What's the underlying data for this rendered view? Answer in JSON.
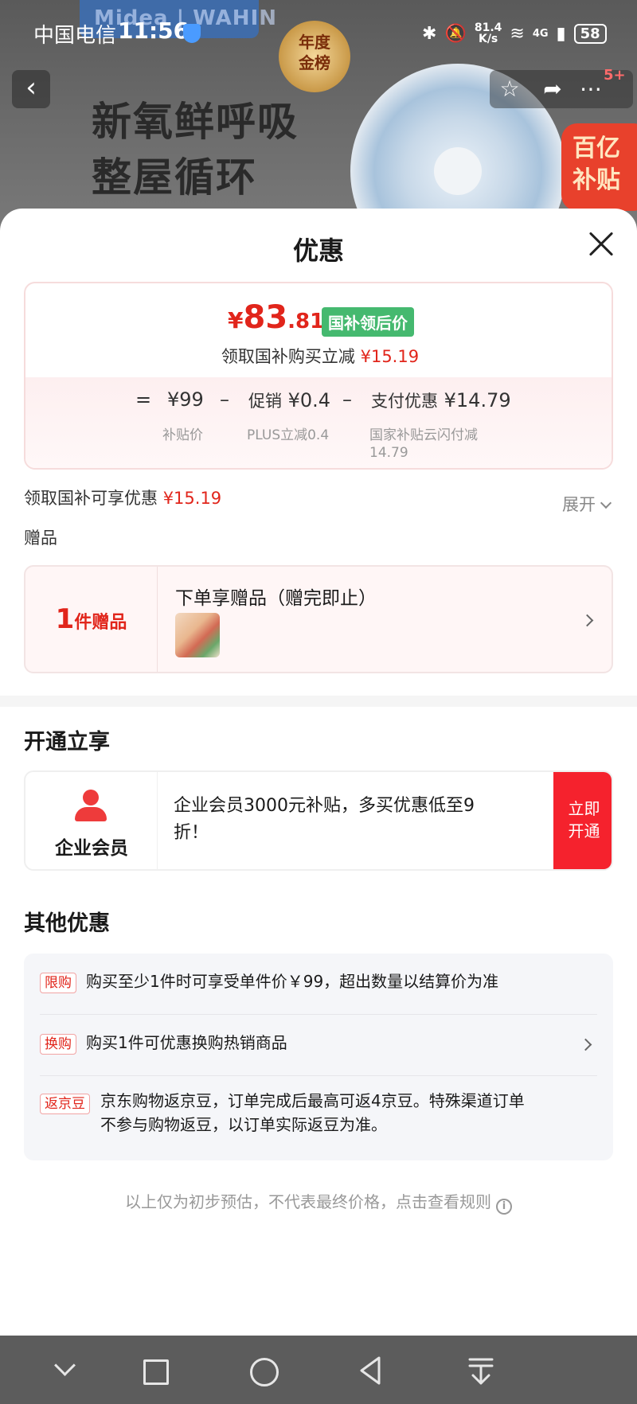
{
  "status_bar": {
    "carrier": "中国电信",
    "time": "11:56",
    "net_speed": "81.4",
    "net_unit": "K/s",
    "network": "4G",
    "battery": "58"
  },
  "banner": {
    "brand": "Midea | WAHIN",
    "award_line1": "年度",
    "award_line2": "金榜",
    "headline_line1": "新氧鲜呼吸",
    "headline_line2": "整屋循环",
    "subsidy_line1": "百亿",
    "subsidy_line2": "补贴",
    "badge": "5+"
  },
  "sheet": {
    "title": "优惠",
    "final_price": {
      "symbol": "¥",
      "integer": "83",
      "decimal": ".81"
    },
    "final_price_tag": "国补领后价",
    "claim_line": {
      "text": "领取国补购买立减",
      "amount": "¥15.19"
    },
    "calc": {
      "equals": "=",
      "base_price": "¥99",
      "base_label": "补贴价",
      "minus1": "–",
      "promo_label": "促销",
      "promo_value": "¥0.4",
      "promo_sub": "PLUS立减0.4",
      "minus2": "–",
      "pay_label": "支付优惠",
      "pay_value": "¥14.79",
      "pay_sub_line1": "国家补贴云闪付减",
      "pay_sub_line2": "14.79"
    },
    "claim_summary": {
      "text": "领取国补可享优惠",
      "amount": "¥15.19"
    },
    "expand_label": "展开",
    "gift_section_label": "赠品",
    "gift": {
      "count": "1",
      "count_label": "件赠品",
      "title": "下单享赠品（赠完即止）"
    },
    "membership_section_title": "开通立享",
    "membership": {
      "label": "企业会员",
      "description": "企业会员3000元补贴，多买优惠低至9折！",
      "button_line1": "立即",
      "button_line2": "开通"
    },
    "other_section_title": "其他优惠",
    "other_offers": [
      {
        "tag": "限购",
        "text": "购买至少1件时可享受单件价￥99，超出数量以结算价为准"
      },
      {
        "tag": "换购",
        "text": "购买1件可优惠换购热销商品"
      },
      {
        "tag": "返京豆",
        "text_line1": "京东购物返京豆，订单完成后最高可返4京豆。特殊渠道订单",
        "text_line2": "不参与购物返豆，以订单实际返豆为准。"
      }
    ],
    "footer_note": "以上仅为初步预估，不代表最终价格，点击查看规则"
  },
  "colors": {
    "accent_red": "#e1251b",
    "tag_green": "#45b96f",
    "button_red": "#f5222d"
  }
}
